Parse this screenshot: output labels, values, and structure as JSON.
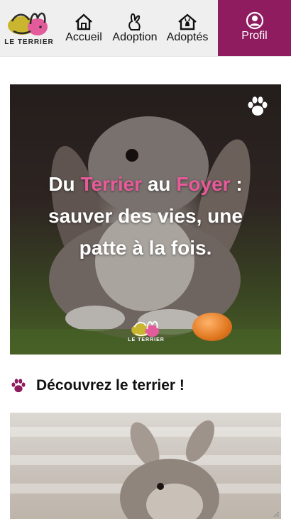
{
  "brand": {
    "name": "LE TERRIER"
  },
  "nav": {
    "items": [
      {
        "label": "Accueil",
        "icon": "home-icon"
      },
      {
        "label": "Adoption",
        "icon": "rabbit-icon"
      },
      {
        "label": "Adoptés",
        "icon": "adopted-home-icon"
      }
    ],
    "profile": {
      "label": "Profil",
      "icon": "user-circle-icon"
    }
  },
  "hero": {
    "title_parts": [
      "Du ",
      "Terrier",
      " au ",
      "Foyer",
      " : sauver des vies, une patte à la fois."
    ],
    "badge_icon": "paw-icon",
    "logo_text": "LE TERRIER"
  },
  "section": {
    "title": "Découvrez le terrier !",
    "icon": "paw-icon"
  },
  "colors": {
    "accent": "#8e1c5f",
    "pink": "#e85a9a",
    "nav_bg": "#efefef"
  }
}
